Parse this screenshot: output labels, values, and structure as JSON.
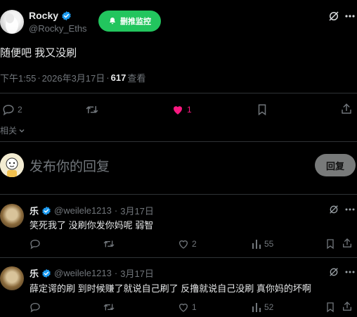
{
  "post": {
    "author_name": "Rocky",
    "author_handle": "@Rocky_Eths",
    "monitor_button": "删推监控",
    "text": "随便吧 我又没刷",
    "time": "下午1:55",
    "sep": "·",
    "date": "2026年3月17日",
    "views_count": "617",
    "views_label": "查看",
    "replies": "2",
    "likes": "1"
  },
  "related": "相关",
  "composer": {
    "placeholder": "发布你的回复",
    "reply_button": "回复"
  },
  "comments": [
    {
      "name": "乐",
      "handle": "@weilele1213",
      "sep": "·",
      "date": "3月17日",
      "text": "笑死我了 没刷你发你妈呢 弱智",
      "replies": "",
      "retweets": "",
      "likes": "2",
      "views": "55"
    },
    {
      "name": "乐",
      "handle": "@weilele1213",
      "sep": "·",
      "date": "3月17日",
      "text": "薛定谔的刷 到时候赚了就说自己刷了 反撸就说自己没刷 真你妈的坏啊",
      "replies": "",
      "retweets": "",
      "likes": "1",
      "views": "52"
    }
  ],
  "colors": {
    "accent_green": "#22c55e",
    "like_pink": "#f91880",
    "verified_blue": "#1d9bf0",
    "muted": "#71767b"
  }
}
